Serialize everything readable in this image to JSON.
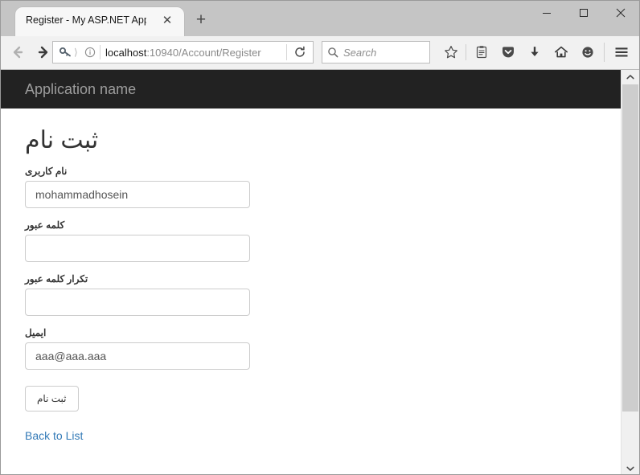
{
  "browser": {
    "tab": {
      "title": "Register - My ASP.NET Applic...",
      "close_label": "✕"
    },
    "new_tab_label": "+",
    "window_controls": {
      "minimize": "minimize",
      "maximize": "maximize",
      "close": "close"
    },
    "address_bar": {
      "host": "localhost",
      "path": ":10940/Account/Register",
      "full_url": "localhost:10940/Account/Register",
      "key_icon": "key-icon",
      "info_icon": "info-icon",
      "reload_icon": "reload-icon"
    },
    "search": {
      "placeholder": "Search",
      "icon": "search-icon"
    },
    "toolbar_icons": [
      "bookmark-star-icon",
      "reading-list-icon",
      "pocket-icon",
      "downloads-icon",
      "home-icon",
      "feedback-smiley-icon",
      "hamburger-menu-icon"
    ],
    "navigation": {
      "back_icon": "back-arrow-icon",
      "forward_icon": "forward-arrow-icon"
    },
    "scrollbar": {
      "up_arrow": "scroll-up-icon",
      "down_arrow": "scroll-down-icon"
    }
  },
  "page": {
    "brand": "Application name",
    "title": "ثبت نام",
    "fields": [
      {
        "label": "نام کاربری",
        "value": "mohammadhosein",
        "type": "text",
        "name": "username"
      },
      {
        "label": "کلمه عبور",
        "value": "",
        "type": "password",
        "name": "password"
      },
      {
        "label": "تکرار کلمه عبور",
        "value": "",
        "type": "password",
        "name": "confirm-password"
      },
      {
        "label": "ایمیل",
        "value": "aaa@aaa.aaa",
        "type": "text",
        "name": "email"
      }
    ],
    "submit_label": "ثبت نام",
    "back_link": "Back to List"
  },
  "colors": {
    "navbar_bg": "#222222",
    "brand_text": "#9d9d9d",
    "link": "#337ab7",
    "input_border": "#cccccc"
  }
}
